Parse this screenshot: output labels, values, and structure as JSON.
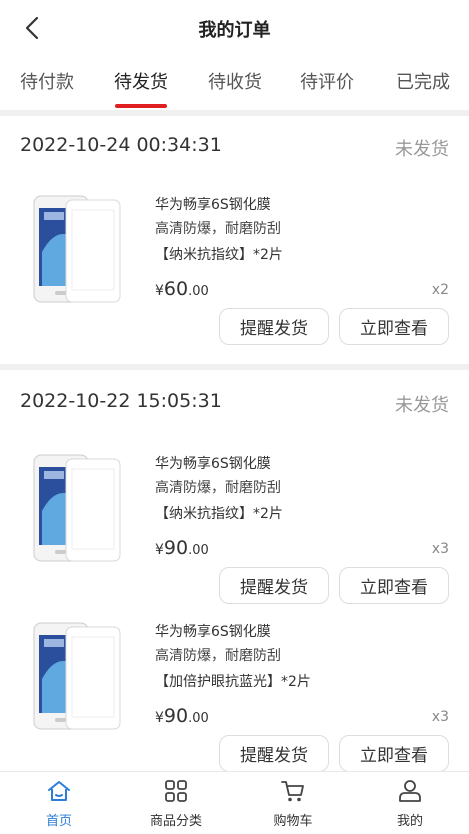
{
  "header": {
    "title": "我的订单"
  },
  "tabs": [
    {
      "label": "待付款"
    },
    {
      "label": "待发货"
    },
    {
      "label": "待收货"
    },
    {
      "label": "待评价"
    },
    {
      "label": "已完成"
    }
  ],
  "orders": [
    {
      "date": "2022-10-24 00:34:31",
      "status": "未发货",
      "items": [
        {
          "name": "华为畅享6S钢化膜",
          "desc": "高清防爆，耐磨防刮",
          "spec": "【纳米抗指纹】*2片",
          "price_yen": "¥",
          "price_int": "60",
          "price_dec": ".00",
          "qty": "x2",
          "remind_label": "提醒发货",
          "view_label": "立即查看"
        }
      ]
    },
    {
      "date": "2022-10-22 15:05:31",
      "status": "未发货",
      "items": [
        {
          "name": "华为畅享6S钢化膜",
          "desc": "高清防爆，耐磨防刮",
          "spec": "【纳米抗指纹】*2片",
          "price_yen": "¥",
          "price_int": "90",
          "price_dec": ".00",
          "qty": "x3",
          "remind_label": "提醒发货",
          "view_label": "立即查看"
        },
        {
          "name": "华为畅享6S钢化膜",
          "desc": "高清防爆，耐磨防刮",
          "spec": "【加倍护眼抗蓝光】*2片",
          "price_yen": "¥",
          "price_int": "90",
          "price_dec": ".00",
          "qty": "x3",
          "remind_label": "提醒发货",
          "view_label": "立即查看"
        }
      ]
    }
  ],
  "bottom_nav": [
    {
      "label": "首页",
      "icon": "home-icon"
    },
    {
      "label": "商品分类",
      "icon": "category-icon"
    },
    {
      "label": "购物车",
      "icon": "cart-icon"
    },
    {
      "label": "我的",
      "icon": "user-icon"
    }
  ],
  "colors": {
    "accent": "#e02020",
    "nav_active": "#2a7ed8"
  }
}
